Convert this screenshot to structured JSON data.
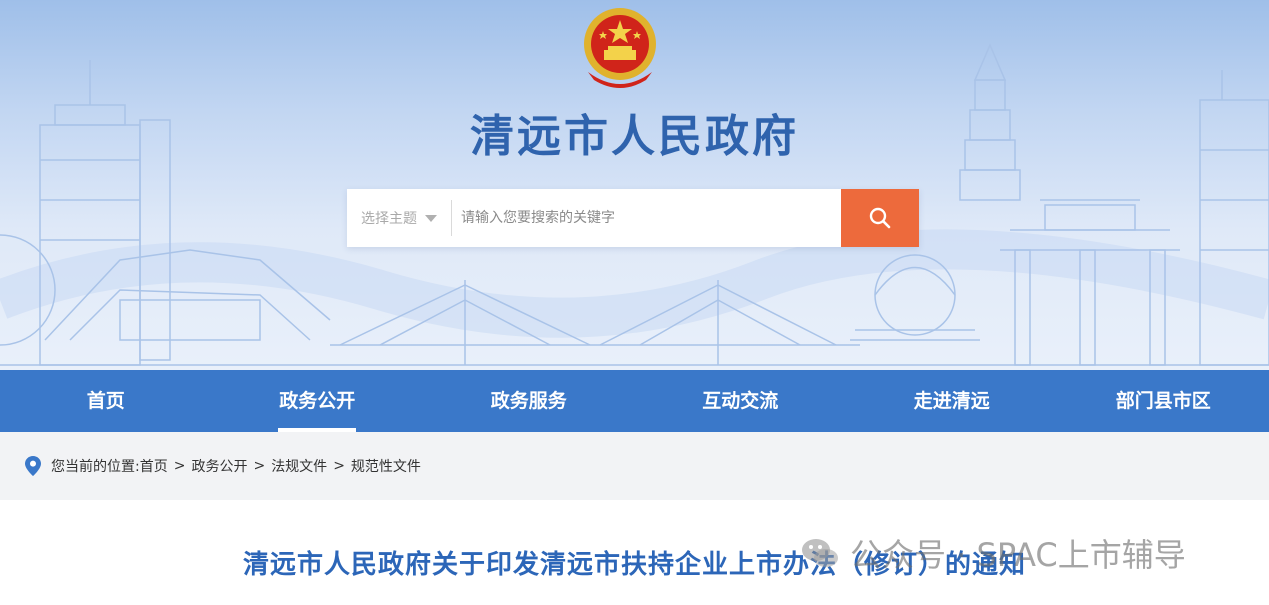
{
  "header": {
    "site_title": "清远市人民政府",
    "search": {
      "topic_label": "选择主题",
      "placeholder": "请输入您要搜索的关键字"
    }
  },
  "nav": {
    "items": [
      "首页",
      "政务公开",
      "政务服务",
      "互动交流",
      "走进清远",
      "部门县市区"
    ],
    "active_index": 1
  },
  "breadcrumb": {
    "prefix": "您当前的位置:",
    "items": [
      "首页",
      "政务公开",
      "法规文件",
      "规范性文件"
    ],
    "separator": ">"
  },
  "article": {
    "title": "清远市人民政府关于印发清远市扶持企业上市办法（修订）的通知"
  },
  "watermark": {
    "text": "公众号 · SPAC上市辅导"
  },
  "colors": {
    "nav_bg": "#3a78c9",
    "title_blue": "#2f63ad",
    "search_button": "#ed6a3c",
    "article_title": "#2c66b8"
  }
}
